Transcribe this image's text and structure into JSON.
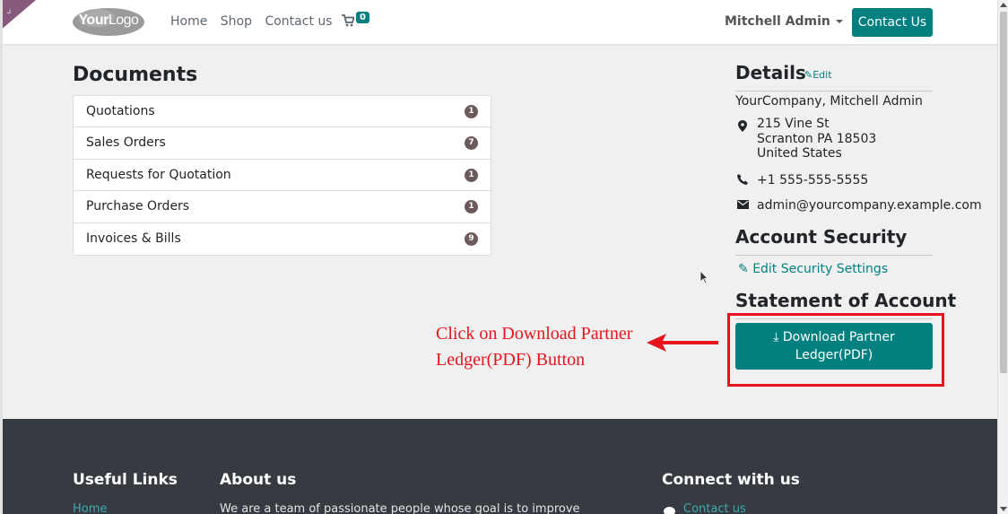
{
  "header": {
    "logo": {
      "part1": "Your",
      "part2": "Logo"
    },
    "nav": [
      "Home",
      "Shop",
      "Contact us"
    ],
    "cart_count": "0",
    "user": "Mitchell Admin",
    "contact_button": "Contact Us"
  },
  "documents": {
    "title": "Documents",
    "items": [
      {
        "label": "Quotations",
        "count": "1"
      },
      {
        "label": "Sales Orders",
        "count": "7"
      },
      {
        "label": "Requests for Quotation",
        "count": "1"
      },
      {
        "label": "Purchase Orders",
        "count": "1"
      },
      {
        "label": "Invoices & Bills",
        "count": "9"
      }
    ]
  },
  "details": {
    "title": "Details",
    "edit": "Edit",
    "company": "YourCompany, Mitchell Admin",
    "address": [
      "215 Vine St",
      "Scranton PA 18503",
      "United States"
    ],
    "phone": "+1 555-555-5555",
    "email": "admin@yourcompany.example.com"
  },
  "security": {
    "title": "Account Security",
    "link": "Edit Security Settings"
  },
  "statement": {
    "title": "Statement of Account",
    "button_line1": "Download Partner",
    "button_line2": "Ledger(PDF)"
  },
  "annotation": {
    "line1": "Click on Download Partner",
    "line2": "Ledger(PDF) Button",
    "color": "#e8141d"
  },
  "footer": {
    "useful_links_title": "Useful Links",
    "useful_link_1": "Home",
    "about_title": "About us",
    "about_text": "We are a team of passionate people whose goal is to improve",
    "connect_title": "Connect with us",
    "connect_link": "Contact us"
  },
  "colors": {
    "primary": "#01807f",
    "footer_bg": "#353b40",
    "badge": "#6c5a5a"
  }
}
